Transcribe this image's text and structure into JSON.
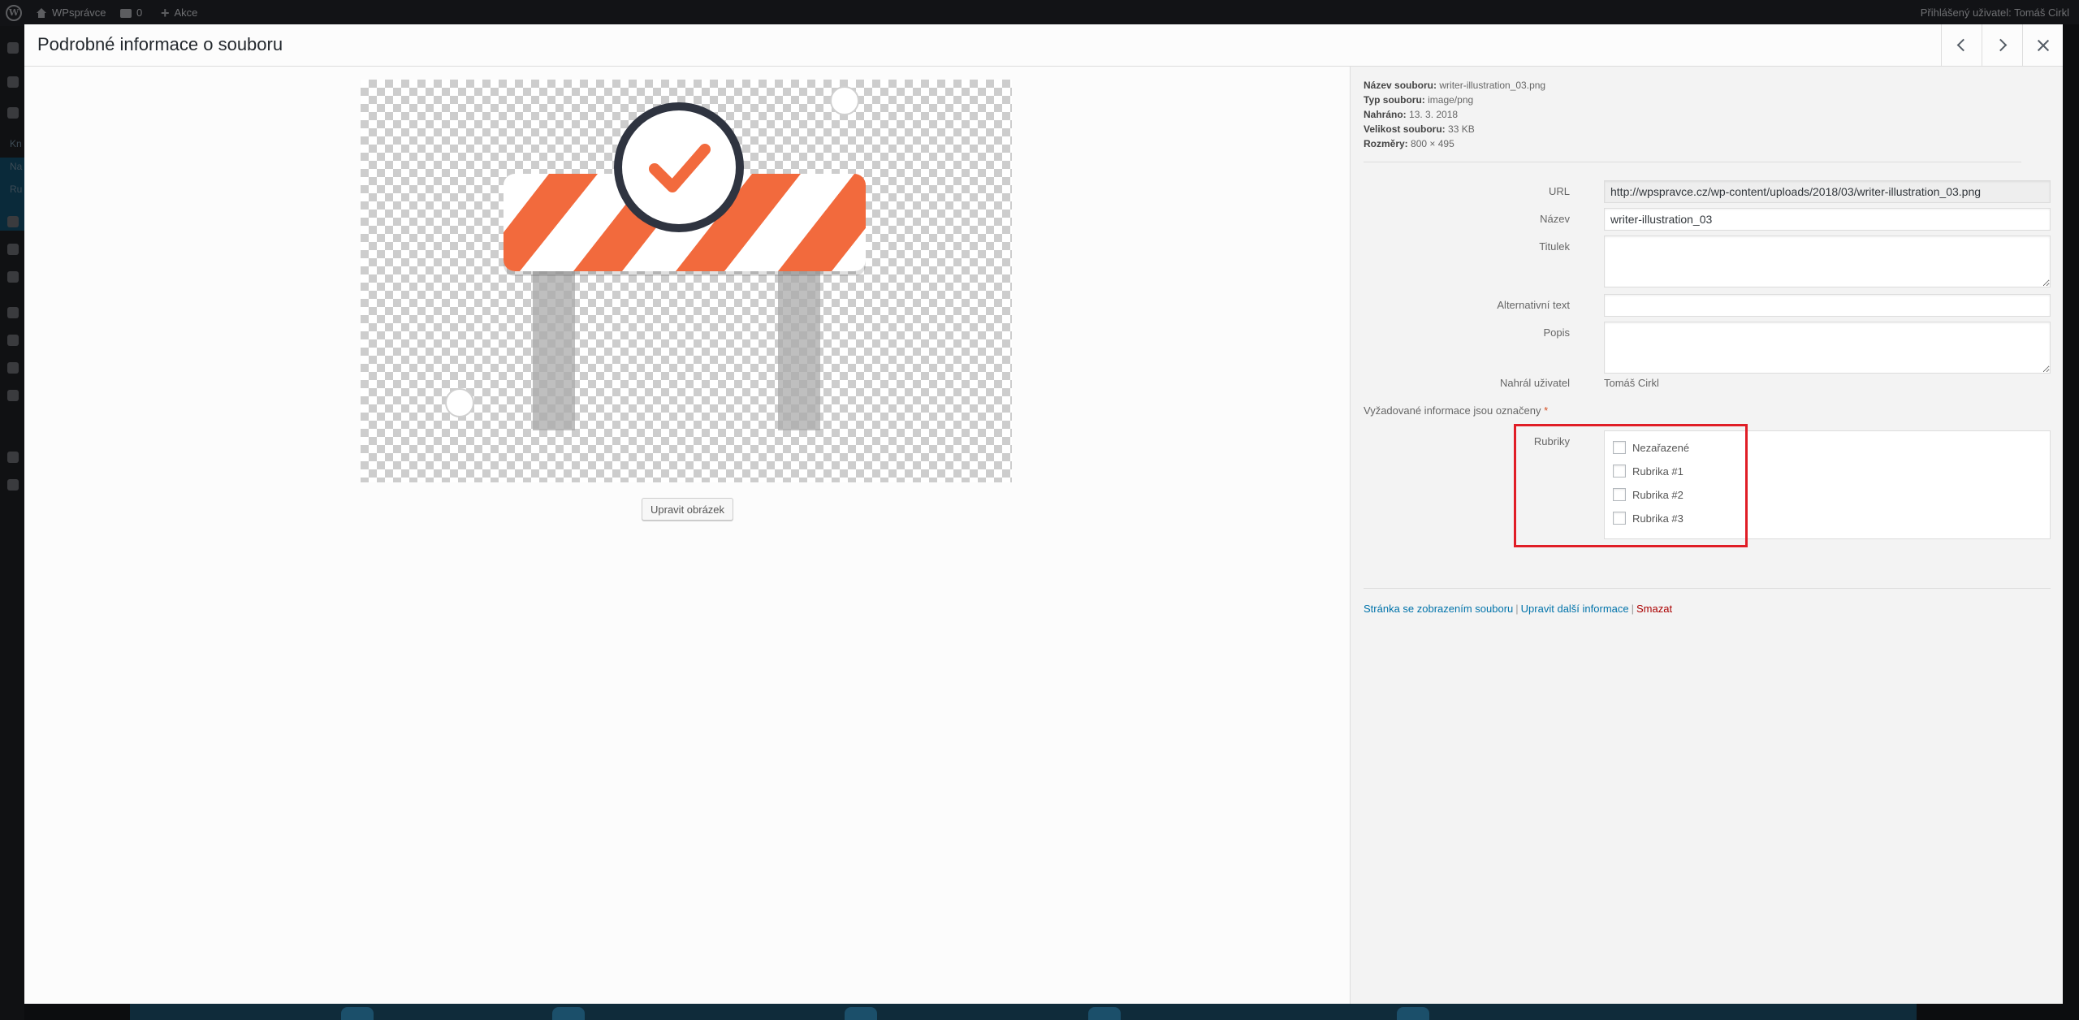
{
  "adminbar": {
    "site_name": "WPsprávce",
    "comments_count": "0",
    "new_label": "Akce",
    "user_label": "Přihlášený uživatel: Tomáš Cirkl"
  },
  "leftmenu": {
    "active_label": "Kn",
    "sub1": "Na",
    "sub2": "Ru"
  },
  "modal": {
    "title": "Podrobné informace o souboru",
    "edit_image_label": "Upravit obrázek"
  },
  "file_meta": {
    "filename_label": "Název souboru:",
    "filename": "writer-illustration_03.png",
    "type_label": "Typ souboru:",
    "type": "image/png",
    "uploaded_label": "Nahráno:",
    "uploaded": "13. 3. 2018",
    "size_label": "Velikost souboru:",
    "size": "33 KB",
    "dims_label": "Rozměry:",
    "dims": "800 × 495"
  },
  "fields": {
    "url_label": "URL",
    "url_value": "http://wpspravce.cz/wp-content/uploads/2018/03/writer-illustration_03.png",
    "name_label": "Název",
    "name_value": "writer-illustration_03",
    "caption_label": "Titulek",
    "caption_value": "",
    "alt_label": "Alternativní text",
    "alt_value": "",
    "desc_label": "Popis",
    "desc_value": "",
    "uploaded_by_label": "Nahrál uživatel",
    "uploaded_by_value": "Tomáš Cirkl"
  },
  "required_note": "Vyžadované informace jsou označeny",
  "required_star": "*",
  "categories": {
    "label": "Rubriky",
    "items": [
      "Nezařazené",
      "Rubrika #1",
      "Rubrika #2",
      "Rubrika #3"
    ]
  },
  "actions": {
    "view_page": "Stránka se zobrazením souboru",
    "edit_more": "Upravit další informace",
    "delete": "Smazat",
    "separator": "|"
  },
  "colors": {
    "highlight": "#e01d26",
    "link": "#0073aa",
    "delete": "#aa0000",
    "stripe": "#f26a3d",
    "check_circle_border": "#2f3440"
  }
}
